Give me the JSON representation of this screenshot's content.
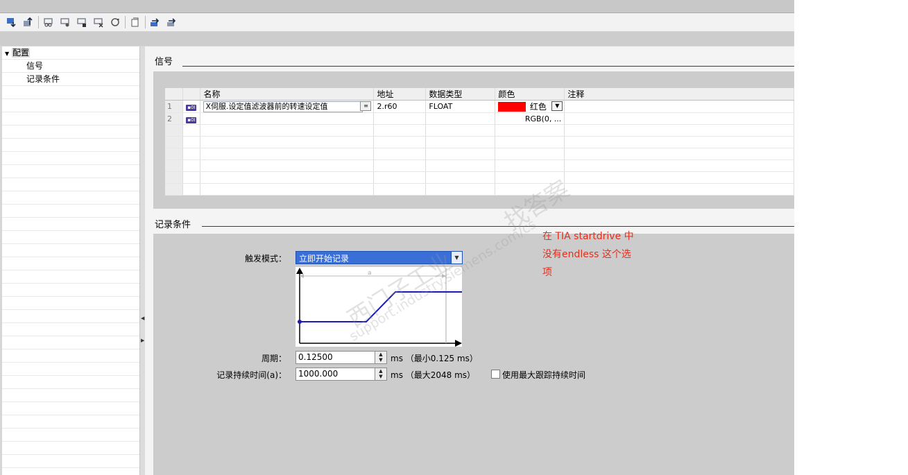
{
  "toolbar": {
    "icons": [
      "download-icon",
      "upload-icon",
      "monitor-icon",
      "monitor-2-icon",
      "monitor-3-icon",
      "delete-measurement-icon",
      "refresh-icon",
      "export-icon",
      "arrow-in-icon",
      "arrow-out-icon"
    ]
  },
  "tree": {
    "root_label": "配置",
    "items": [
      "信号",
      "记录条件"
    ]
  },
  "signals": {
    "section_title": "信号",
    "columns": [
      "名称",
      "地址",
      "数据类型",
      "颜色",
      "注释"
    ],
    "rows": [
      {
        "num": "1",
        "name": "X伺服.设定值滤波器前的转速设定值",
        "address": "2.r60",
        "datatype": "FLOAT",
        "color_swatch": "#ff0000",
        "color_name": "红色",
        "comment": ""
      },
      {
        "num": "2",
        "name": "",
        "address": "",
        "datatype": "",
        "color_swatch": "",
        "color_name": "RGB(0, ...",
        "comment": ""
      }
    ],
    "empty_rows": 6
  },
  "recording": {
    "section_title": "记录条件",
    "trigger_label": "触发模式：",
    "trigger_value": "立即开始记录",
    "trigger_diagram_label": "a",
    "period_label": "周期：",
    "period_value": "0.12500",
    "period_unit": "ms （最小0.125 ms）",
    "duration_label": "记录持续时间(a)：",
    "duration_value": "1000.000",
    "duration_unit": "ms （最大2048 ms）",
    "max_duration_checkbox_label": "使用最大跟踪持续时间",
    "max_duration_checked": false
  },
  "annotation": {
    "lines": [
      "在 TIA startdrive 中",
      "没有endless 这个选",
      "项"
    ],
    "color": "#e0301e"
  },
  "watermark": {
    "line1": "西门子工业",
    "line2": "support.industry.siemens.com/cs",
    "line3": "找答案"
  }
}
